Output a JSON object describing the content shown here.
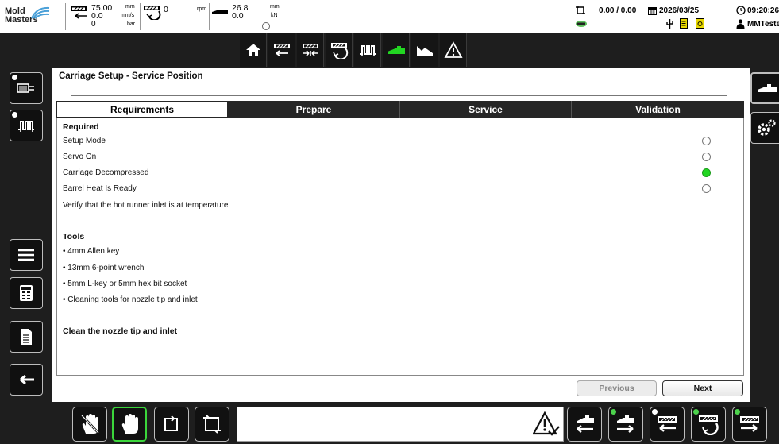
{
  "status": {
    "logo_line1": "Mold",
    "logo_line2": "Masters",
    "position_value": "75.00",
    "position_unit": "mm",
    "speed_value": "0.0",
    "speed_unit": "mm/s",
    "pressure_value": "0",
    "pressure_unit": "bar",
    "screw_rpm_value": "0",
    "screw_rpm_unit": "rpm",
    "carriage_position_value": "26.8",
    "carriage_position_unit": "mm",
    "carriage_force_value": "0.0",
    "carriage_force_unit": "kN",
    "counter": "0.00 / 0.00",
    "date": "2026/03/25",
    "time": "09:20:26",
    "user": "MMTester"
  },
  "nav": {
    "items": [
      "home-icon",
      "injection-icon",
      "clamp-icon",
      "screw-icon",
      "heater-icon",
      "carriage-icon",
      "chart-icon",
      "alarm-icon"
    ],
    "active": "carriage-icon"
  },
  "page": {
    "title": "Carriage Setup - Service Position",
    "tabs": [
      "Requirements",
      "Prepare",
      "Service",
      "Validation"
    ],
    "active_tab": "Requirements",
    "required_heading": "Required",
    "requirements": [
      {
        "label": "Setup Mode",
        "met": false
      },
      {
        "label": "Servo On",
        "met": false
      },
      {
        "label": "Carriage Decompressed",
        "met": true
      },
      {
        "label": "Barrel Heat Is Ready",
        "met": false
      }
    ],
    "verify_note": "Verify that the hot runner inlet is at temperature",
    "tools_heading": "Tools",
    "tools": [
      "• 4mm Allen key",
      "• 13mm 6-point wrench",
      "• 5mm L-key or 5mm hex bit socket",
      "• Cleaning tools for nozzle tip and inlet"
    ],
    "final_step": "Clean the nozzle tip and inlet",
    "previous_label": "Previous",
    "next_label": "Next"
  },
  "colors": {
    "accent_green": "#22d622",
    "dark": "#1e1e1e"
  }
}
